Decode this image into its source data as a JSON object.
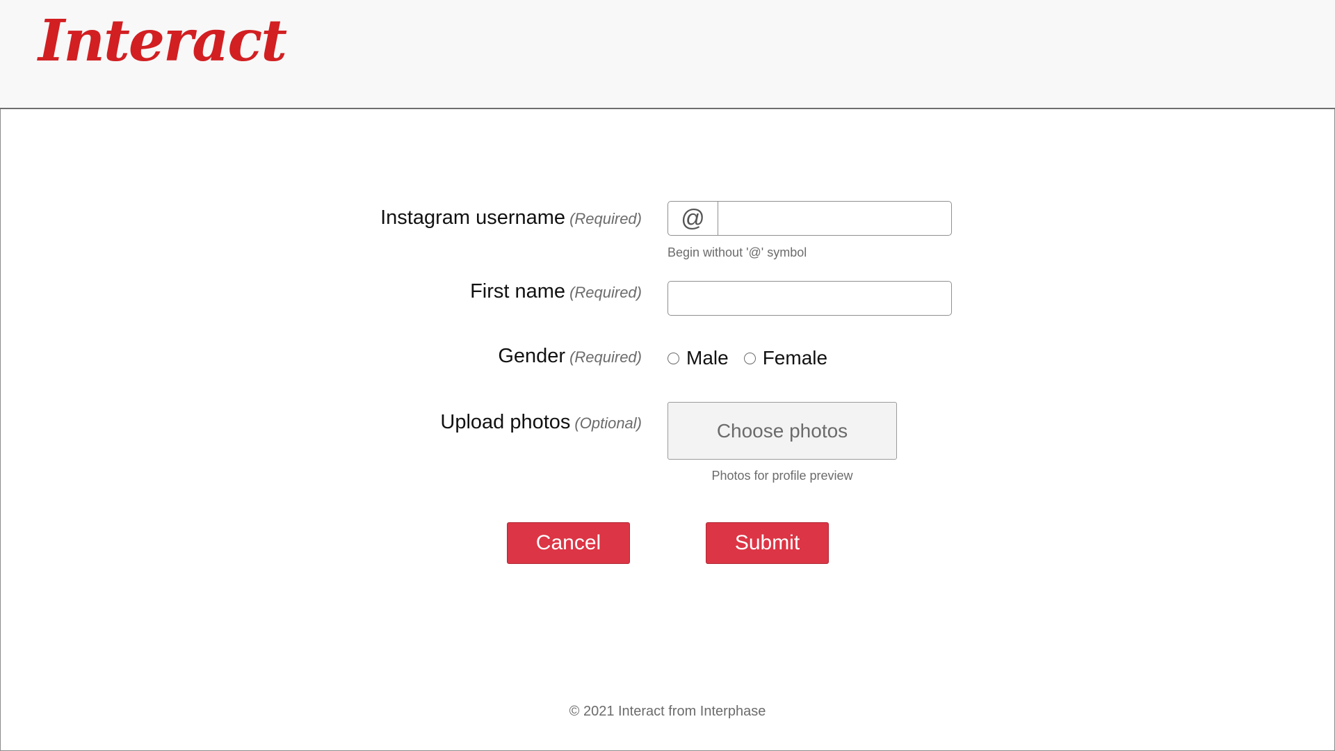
{
  "brand": {
    "logo_text": "Interact",
    "logo_color": "#d21f22"
  },
  "form": {
    "username": {
      "label": "Instagram username",
      "tag": "(Required)",
      "prefix": "@",
      "value": "",
      "help": "Begin without '@' symbol"
    },
    "first_name": {
      "label": "First name",
      "tag": "(Required)",
      "value": ""
    },
    "gender": {
      "label": "Gender",
      "tag": "(Required)",
      "options": [
        "Male",
        "Female"
      ],
      "selected": null
    },
    "photos": {
      "label": "Upload photos",
      "tag": "(Optional)",
      "button_label": "Choose photos",
      "help": "Photos for profile preview"
    }
  },
  "actions": {
    "cancel_label": "Cancel",
    "submit_label": "Submit",
    "button_color": "#dc3545"
  },
  "footer": {
    "text": "© 2021 Interact from Interphase"
  }
}
